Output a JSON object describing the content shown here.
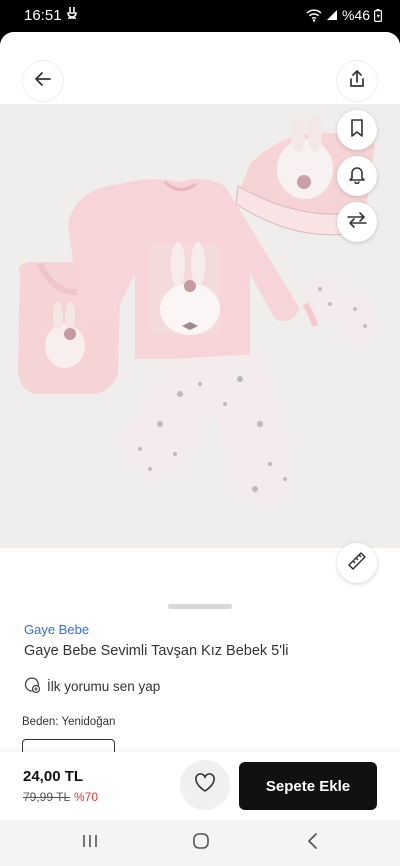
{
  "status_bar": {
    "time": "16:51",
    "notification_icon": "rabbit-notification-icon",
    "signal_text": "%46",
    "icons": [
      "wifi-icon",
      "signal-icon",
      "battery-icon"
    ]
  },
  "top_bar": {
    "back_icon": "arrow-left-icon",
    "share_icon": "share-icon"
  },
  "side_actions": {
    "icons": [
      "bookmark-icon",
      "bell-icon",
      "compare-arrows-icon",
      "ruler-icon"
    ]
  },
  "product": {
    "brand": "Gaye Bebe",
    "title": "Gaye Bebe Sevimli Tavşan Kız Bebek 5'li",
    "review_link": "İlk yorumu sen yap",
    "size_label": "Beden:",
    "size_value": "Yenidoğan"
  },
  "purchase": {
    "price": "24,00 TL",
    "old_price": "79,99 TL",
    "discount": "%70",
    "add_to_cart": "Sepete Ekle"
  },
  "colors": {
    "brand_link": "#3a6fd8",
    "discount": "#e53935",
    "cart_button": "#111111"
  }
}
